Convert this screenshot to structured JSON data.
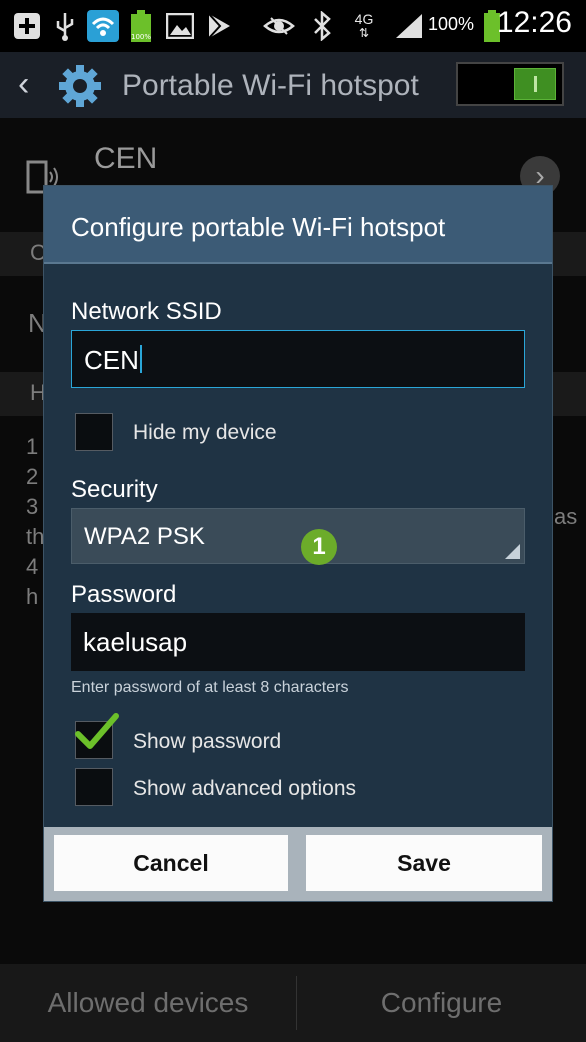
{
  "status_bar": {
    "icons": [
      "add-box-icon",
      "usb-icon",
      "wifi-hotspot-icon",
      "battery-full-icon",
      "image-icon",
      "play-store-icon",
      "eye-icon",
      "bluetooth-icon",
      "4g-icon",
      "signal-icon"
    ],
    "net_type": "4G",
    "battery_percent": "100%",
    "time": "12:26"
  },
  "action_bar": {
    "title": "Portable Wi-Fi hotspot",
    "toggle_on": true
  },
  "background": {
    "ssid_name": "CEN",
    "section1_letter": "C",
    "row_letter": "N",
    "section2_letter": "H",
    "list_left": [
      "1",
      "2",
      "3",
      "th",
      "4",
      "h"
    ],
    "list_right": "as"
  },
  "dialog": {
    "title": "Configure portable Wi-Fi hotspot",
    "ssid_label": "Network SSID",
    "ssid_value": "CEN",
    "hide_device_label": "Hide my device",
    "hide_device_checked": false,
    "security_label": "Security",
    "security_value": "WPA2 PSK",
    "annotation_number": "1",
    "password_label": "Password",
    "password_value": "kaelusap",
    "password_helper": "Enter password of at least 8 characters",
    "show_password_label": "Show password",
    "show_password_checked": true,
    "show_advanced_label": "Show advanced options",
    "show_advanced_checked": false,
    "cancel_label": "Cancel",
    "save_label": "Save"
  },
  "bottom_bar": {
    "allowed_devices_label": "Allowed devices",
    "configure_label": "Configure"
  }
}
